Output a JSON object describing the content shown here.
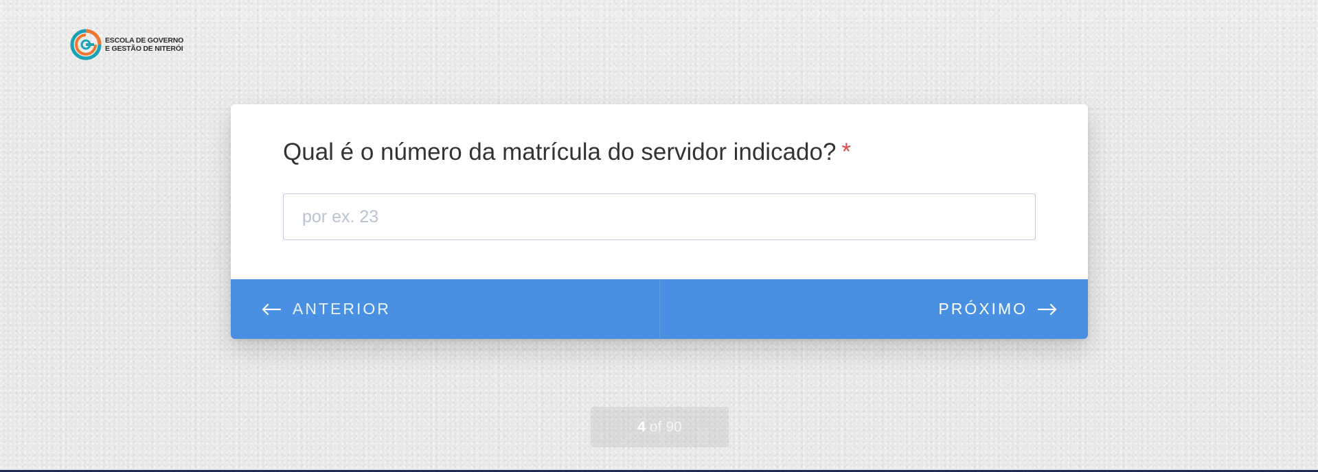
{
  "logo": {
    "line1": "ESCOLA DE GOVERNO",
    "line2": "E GESTÃO DE NITERÓI",
    "icon": "egg-logo-icon",
    "colors": {
      "teal": "#1aa3b4",
      "orange": "#f0752f"
    }
  },
  "question": {
    "text": "Qual é o número da matrícula do servidor indicado?",
    "required_mark": "*"
  },
  "answer": {
    "placeholder": "por ex. 23",
    "value": ""
  },
  "nav": {
    "prev_label": "ANTERIOR",
    "next_label": "PRÓXIMO",
    "prev_icon": "arrow-left-icon",
    "next_icon": "arrow-right-icon"
  },
  "progress": {
    "current": "4",
    "of": "of",
    "total": "90"
  },
  "colors": {
    "accent": "#4a90e2",
    "required": "#e54b4b",
    "background": "#e9e9e9"
  }
}
